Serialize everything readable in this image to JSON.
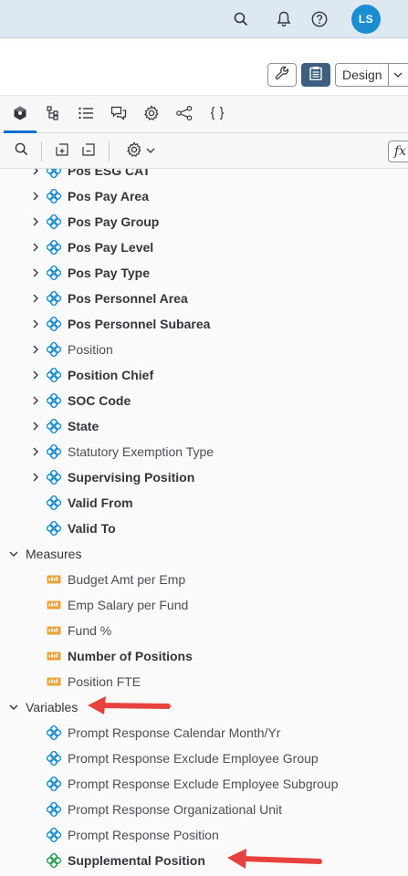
{
  "shell": {
    "user_initials": "LS",
    "avatar_color": "#1b8ed1"
  },
  "appbar": {
    "design_label": "Design"
  },
  "tabs": [
    "model-icon",
    "hierarchy-icon",
    "list-icon",
    "comments-icon",
    "settings-icon",
    "share-icon",
    "code-icon"
  ],
  "tree": {
    "partial_item": "Pos ESG CAT",
    "dimensions": [
      {
        "label": "Pos Pay Area",
        "bold": true,
        "expandable": true
      },
      {
        "label": "Pos Pay Group",
        "bold": true,
        "expandable": true
      },
      {
        "label": "Pos Pay Level",
        "bold": true,
        "expandable": true
      },
      {
        "label": "Pos Pay Type",
        "bold": true,
        "expandable": true
      },
      {
        "label": "Pos Personnel Area",
        "bold": true,
        "expandable": true
      },
      {
        "label": "Pos Personnel Subarea",
        "bold": true,
        "expandable": true
      },
      {
        "label": "Position",
        "bold": false,
        "expandable": true
      },
      {
        "label": "Position Chief",
        "bold": true,
        "expandable": true
      },
      {
        "label": "SOC Code",
        "bold": true,
        "expandable": true
      },
      {
        "label": "State",
        "bold": true,
        "expandable": true
      },
      {
        "label": "Statutory Exemption Type",
        "bold": false,
        "expandable": true
      },
      {
        "label": "Supervising Position",
        "bold": true,
        "expandable": true
      },
      {
        "label": "Valid From",
        "bold": true,
        "expandable": false
      },
      {
        "label": "Valid To",
        "bold": true,
        "expandable": false
      }
    ],
    "measures_label": "Measures",
    "measures": [
      {
        "label": "Budget Amt per Emp",
        "bold": false
      },
      {
        "label": "Emp Salary per Fund",
        "bold": false
      },
      {
        "label": "Fund %",
        "bold": false
      },
      {
        "label": "Number of Positions",
        "bold": true
      },
      {
        "label": "Position FTE",
        "bold": false
      }
    ],
    "variables_label": "Variables",
    "variables": [
      {
        "label": "Prompt Response Calendar Month/Yr",
        "bold": false,
        "icon_color": "#1b8ed1"
      },
      {
        "label": "Prompt Response Exclude Employee Group",
        "bold": false,
        "icon_color": "#1b8ed1"
      },
      {
        "label": "Prompt Response Exclude Employee Subgroup",
        "bold": false,
        "icon_color": "#1b8ed1"
      },
      {
        "label": "Prompt Response Organizational Unit",
        "bold": false,
        "icon_color": "#1b8ed1"
      },
      {
        "label": "Prompt Response Position",
        "bold": false,
        "icon_color": "#1b8ed1"
      },
      {
        "label": "Supplemental Position",
        "bold": true,
        "icon_color": "#2e9e4f"
      }
    ]
  },
  "colors": {
    "dimension_icon": "#1b8ed1",
    "measure_icon": "#e8a33b",
    "arrow": "#e8423e"
  }
}
